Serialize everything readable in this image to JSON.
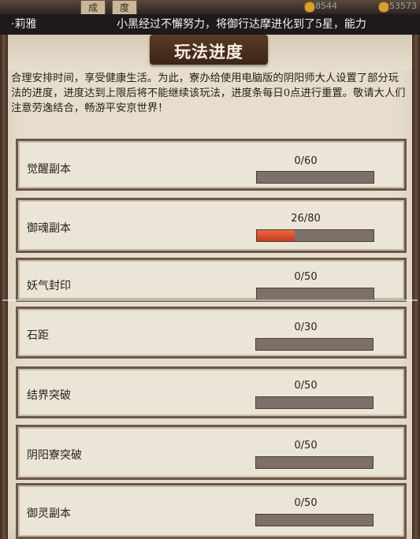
{
  "topbar": {
    "tab_1": "成",
    "tab_2": "度",
    "stat_1": "8544",
    "stat_2": "53573"
  },
  "marquee": {
    "name": "·莉雅",
    "message": "小黑经过不懈努力，将御行达摩进化到了5星，能力"
  },
  "page_title": "玩法进度",
  "intro_text": "合理安排时间，享受健康生活。为此，寮办给使用电脑版的阴阳师大人设置了部分玩法的进度，进度达到上限后将不能继续该玩法，进度条每日0点进行重置。敬请大人们注意劳逸结合，畅游平安京世界！",
  "progress_items": [
    {
      "label": "觉醒副本",
      "count": "0/60",
      "current": 0,
      "max": 60
    },
    {
      "label": "御魂副本",
      "count": "26/80",
      "current": 26,
      "max": 80
    },
    {
      "label": "妖气封印",
      "count": "0/50",
      "current": 0,
      "max": 50
    },
    {
      "label": "石距",
      "count": "0/30",
      "current": 0,
      "max": 30
    },
    {
      "label": "结界突破",
      "count": "0/50",
      "current": 0,
      "max": 50
    },
    {
      "label": "阴阳寮突破",
      "count": "0/50",
      "current": 0,
      "max": 50
    },
    {
      "label": "御灵副本",
      "count": "0/50",
      "current": 0,
      "max": 50
    }
  ]
}
